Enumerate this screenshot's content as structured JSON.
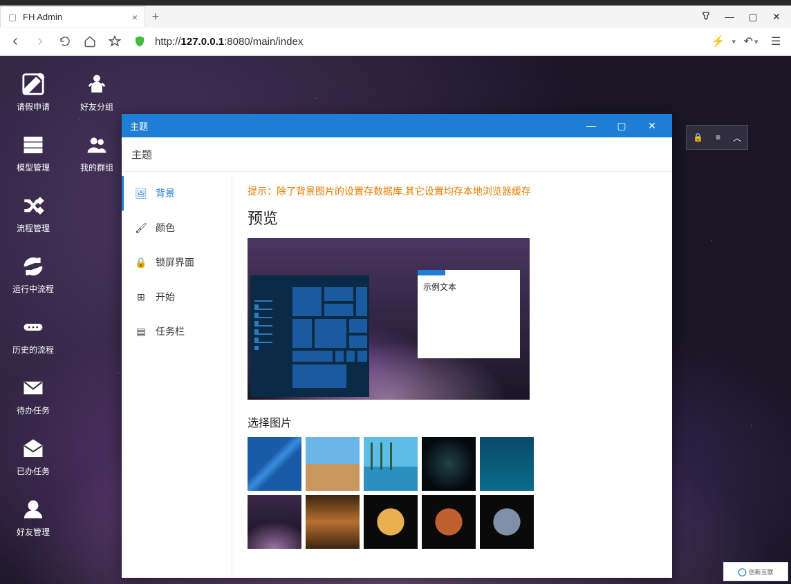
{
  "browser": {
    "tab_title": "FH Admin",
    "url_prefix": "http://",
    "url_host": "127.0.0.1",
    "url_port_path": ":8080/main/index"
  },
  "desktop_icons": [
    {
      "label": "请假申请",
      "icon": "edit"
    },
    {
      "label": "好友分组",
      "icon": "person"
    },
    {
      "label": "模型管理",
      "icon": "layers"
    },
    {
      "label": "我的群组",
      "icon": "group"
    },
    {
      "label": "流程管理",
      "icon": "shuffle"
    },
    {
      "label": "",
      "icon": ""
    },
    {
      "label": "运行中流程",
      "icon": "sync"
    },
    {
      "label": "",
      "icon": ""
    },
    {
      "label": "历史的流程",
      "icon": "dots"
    },
    {
      "label": "",
      "icon": ""
    },
    {
      "label": "待办任务",
      "icon": "mail"
    },
    {
      "label": "",
      "icon": ""
    },
    {
      "label": "已办任务",
      "icon": "mail-open"
    },
    {
      "label": "",
      "icon": ""
    },
    {
      "label": "好友管理",
      "icon": "user"
    },
    {
      "label": "",
      "icon": ""
    }
  ],
  "theme_window": {
    "title": "主题",
    "subtitle": "主题",
    "side_items": [
      {
        "label": "背景",
        "icon": "image",
        "active": true
      },
      {
        "label": "颜色",
        "icon": "brush",
        "active": false
      },
      {
        "label": "锁屏界面",
        "icon": "lock",
        "active": false
      },
      {
        "label": "开始",
        "icon": "win",
        "active": false
      },
      {
        "label": "任务栏",
        "icon": "taskbar",
        "active": false
      }
    ],
    "hint": "提示：除了背景图片的设置存数据库,其它设置均存本地浏览器缓存",
    "preview_heading": "预览",
    "sample_text": "示例文本",
    "select_heading": "选择图片",
    "thumbs": [
      "th1",
      "th2",
      "th3",
      "th4",
      "th5",
      "th6",
      "th7",
      "th8",
      "th9",
      "th10"
    ]
  },
  "panel_icons": [
    "lock-icon",
    "list-icon",
    "chevron-up-icon"
  ],
  "watermark": "创新互联"
}
